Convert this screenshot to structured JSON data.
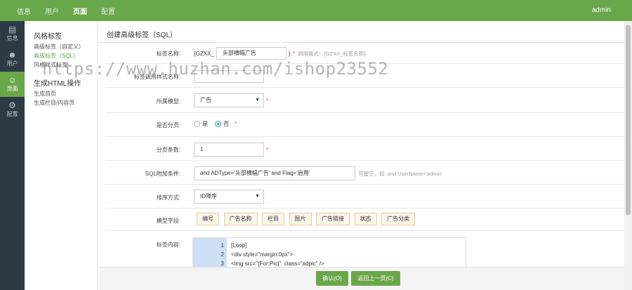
{
  "topnav": {
    "items": [
      "信息",
      "用户",
      "页面",
      "配置"
    ],
    "active_index": 2,
    "user": "admin"
  },
  "leftbar": {
    "items": [
      {
        "label": "信息",
        "icon": "doc-icon"
      },
      {
        "label": "用户",
        "icon": "users-icon"
      },
      {
        "label": "页面",
        "icon": "page-user-icon"
      },
      {
        "label": "配置",
        "icon": "gear-icon"
      }
    ],
    "active_index": 2
  },
  "subnav": {
    "section1_title": "风格标签",
    "section1_links": [
      "高级标签（自定义）",
      "高级标签（SQL）",
      "风格样式标签"
    ],
    "active_link": "高级标签（SQL）",
    "section2_title": "生成HTML操作",
    "section2_links": [
      "生成首页",
      "生成栏目/内容页"
    ]
  },
  "header": {
    "title": "创建高级标签（SQL）"
  },
  "form": {
    "tag_name": {
      "label": "标签名称:",
      "prefix": "{GZXX_",
      "value": "头部横幅广告",
      "suffix": "}",
      "req": "*",
      "hint": "调用格式：{GZXX_标签名称}"
    },
    "style_name": {
      "label": "标签调用样式名称:",
      "value": ""
    },
    "model": {
      "label": "所属模型:",
      "value": "广告",
      "req": "*"
    },
    "paging": {
      "label": "是否分页:",
      "opt_yes": "是",
      "opt_no": "否",
      "selected": "否",
      "req": "*"
    },
    "page_size": {
      "label": "分页条数:",
      "value": "1",
      "req": "*"
    },
    "sql_cond": {
      "label": "SQL附加条件:",
      "value": "and ADType='头部横幅广告' and Flag='启用'",
      "hint": "可留空，如: and UserName='admin'"
    },
    "sort": {
      "label": "排序方式:",
      "value": "ID降序"
    },
    "model_fields": {
      "label": "模型字段:",
      "buttons": [
        "编号",
        "广告名称",
        "栏目",
        "图片",
        "广告链接",
        "状态",
        "广告分类"
      ]
    },
    "content": {
      "label": "标签内容:",
      "lines": [
        {
          "n": "1",
          "text": "[Loop]"
        },
        {
          "n": "2",
          "text": "<div style=\"margin:0px\">"
        },
        {
          "n": "3",
          "text": "<img src=\"{For:Pic}\"  class=\"adpic\" />"
        }
      ]
    }
  },
  "footer": {
    "confirm": "确认(O)",
    "back": "返回上一页(C)"
  },
  "watermark": "https://www.huzhan.com/ishop23552",
  "colors": {
    "accent": "#6aa64a",
    "sidebar": "#2b3a44",
    "required": "#e33333"
  }
}
